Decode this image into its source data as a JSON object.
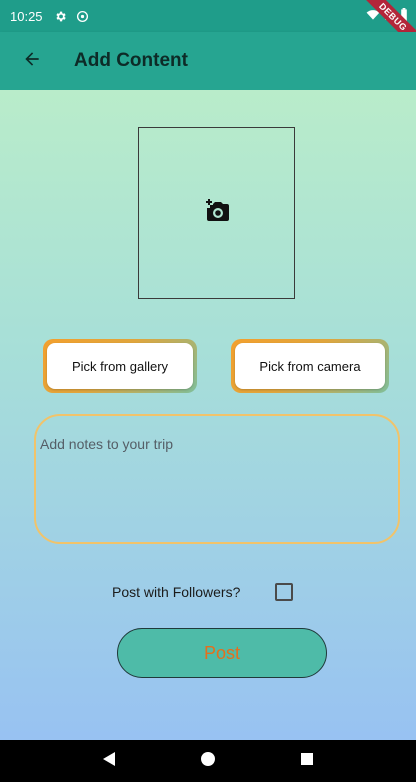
{
  "status_bar": {
    "time": "10:25",
    "debug_label": "DEBUG"
  },
  "app_bar": {
    "title": "Add Content"
  },
  "image_picker": {
    "icon": "add-a-photo-icon"
  },
  "buttons": {
    "gallery_label": "Pick from gallery",
    "camera_label": "Pick from camera",
    "post_label": "Post"
  },
  "notes": {
    "placeholder": "Add notes to your trip",
    "value": ""
  },
  "followers": {
    "label": "Post with Followers?",
    "checked": false
  },
  "nav": {
    "back": "back-triangle-icon",
    "home": "home-circle-icon",
    "recents": "recents-square-icon"
  },
  "colors": {
    "status_bar": "#1f9d8a",
    "app_bar": "#26a591",
    "post_button": "#4ebba8",
    "post_text": "#e56f1c",
    "notes_border": "#f1c36a"
  }
}
